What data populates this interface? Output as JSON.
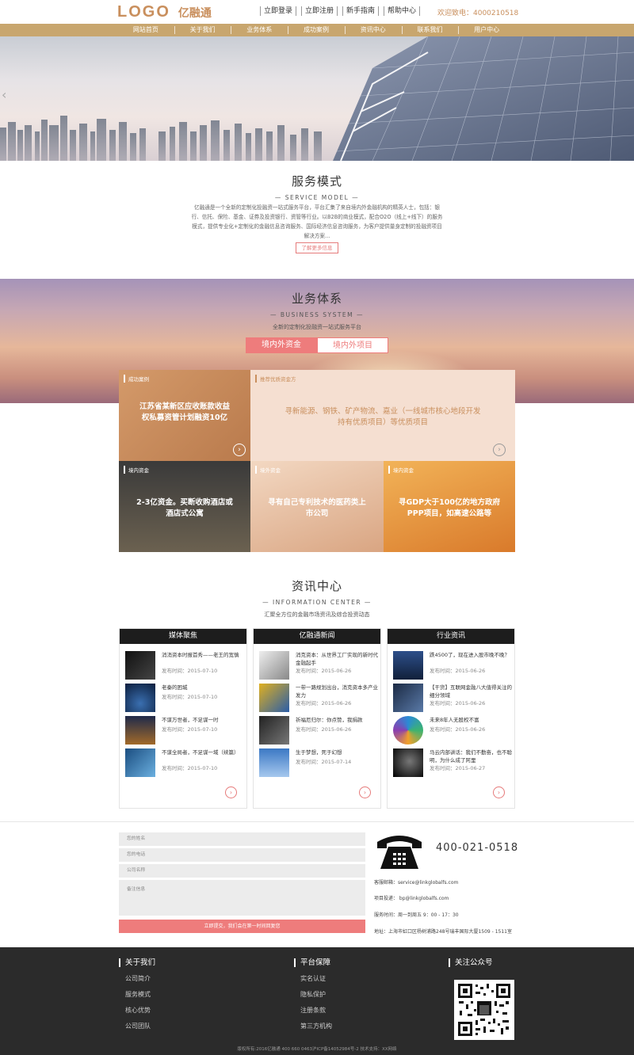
{
  "header": {
    "logo_en": "LOGO",
    "logo_cn": "亿融通",
    "links": [
      "立即登录",
      "立即注册",
      "新手指南",
      "帮助中心"
    ],
    "hotline": "欢迎致电：4000210518"
  },
  "nav": [
    "网站首页",
    "关于我们",
    "业务体系",
    "成功案例",
    "资讯中心",
    "联系我们",
    "用户中心"
  ],
  "service": {
    "title": "服务模式",
    "subtitle": "— SERVICE MODEL —",
    "desc": "亿融通是一个全新的定制化投融资一站式服务平台，平台汇集了来自境内外金融机构的精英人士，包括：银行、信托、保险、基金、证券及投资银行、资管等行业。以B2B的商业模式，配合O2O（线上+线下）的服务模式，提供专业化+定制化的金融信息咨询服务、国际经济信息咨询服务，为客户提供量身定制的投融资项目解决方案...",
    "button": "了解更多信息"
  },
  "business": {
    "title": "业务体系",
    "subtitle": "— BUSINESS SYSTEM —",
    "tagline": "全新的定制化投融资一站式服务平台",
    "tabs": [
      "境内外资金",
      "境内外项目"
    ],
    "cards": [
      {
        "tag": "成功案例",
        "text": "江苏省某新区应收账款收益权私募资管计划融资10亿"
      },
      {
        "tag": "推荐优质资金方",
        "text": "寻新能源、钢铁、矿产物流、嘉业（一线城市核心地段开发持有优质项目）等优质项目"
      },
      {
        "tag": "境内资金",
        "text": "2-3亿资金。买断收购酒店或酒店式公寓"
      },
      {
        "tag": "境外资金",
        "text": "寻有自己专利技术的医药类上市公司"
      },
      {
        "tag": "境内资金",
        "text": "寻GDP大于100亿的地方政府PPP项目，如高速公路等"
      }
    ]
  },
  "info": {
    "title": "资讯中心",
    "subtitle": "— INFORMATION CENTER —",
    "tagline": "汇聚全方位的金融市场资讯及综合投资动态",
    "columns": [
      {
        "head": "媒体聚焦",
        "items": [
          {
            "t": "消消资本时报首秀——老王的宽慎",
            "d": "发布时间：2015-07-10"
          },
          {
            "t": "老秦的困城",
            "d": "发布时间：2015-07-10"
          },
          {
            "t": "不谋万世者，不足谋一时",
            "d": "发布时间：2015-07-10"
          },
          {
            "t": "不谋全局者，不足谋一域（续篇）",
            "d": "发布时间：2015-07-10"
          }
        ]
      },
      {
        "head": "亿融通新闻",
        "items": [
          {
            "t": "消克资本：从世界工厂实现的新时代金融起手",
            "d": "发布时间：2015-06-26"
          },
          {
            "t": "一带一路规划出台，消克资本多产业发力",
            "d": "发布时间：2015-06-26"
          },
          {
            "t": "祈福厄归尔：你点赞，我捐款",
            "d": "发布时间：2015-06-26"
          },
          {
            "t": "生于梦想，死于幻想",
            "d": "发布时间：2015-07-14"
          }
        ]
      },
      {
        "head": "行业资讯",
        "items": [
          {
            "t": "跌4500了，现在进入股市晚不晚？",
            "d": "发布时间：2015-06-26"
          },
          {
            "t": "【干货】互联网金融八大值得关注的细分领域",
            "d": "发布时间：2015-06-26"
          },
          {
            "t": "未来8年人无股权不富",
            "d": "发布时间：2015-06-26"
          },
          {
            "t": "马云内部讲话：我们不勤奋，也不聪明，为什么成了阿里",
            "d": "发布时间：2015-06-27"
          }
        ]
      }
    ]
  },
  "contact": {
    "fields": [
      "您的姓名",
      "您的电话",
      "公司名称",
      "备注信息"
    ],
    "submit": "立即提交，我们会在第一时间回复您",
    "phone": "400-021-0518",
    "email": "客服邮箱：service@linkglobalfs.com",
    "project": "项目投递：  bp@linkglobalfs.com",
    "hours": "服务时间：周一到周五 9：00 - 17：30",
    "address": "地址：上海市虹口区杨树浦路248号瑞丰国际大厦1509 - 1511室"
  },
  "footer": {
    "about": {
      "head": "关于我们",
      "links": [
        "公司简介",
        "服务模式",
        "核心优势",
        "公司团队"
      ]
    },
    "platform": {
      "head": "平台保障",
      "links": [
        "实名认证",
        "隐私保护",
        "注册条款",
        "第三方机构"
      ]
    },
    "wechat": {
      "head": "关注公众号"
    },
    "copyright": "版权所有:2016亿融通 400 660 0463沪ICP备14052984号-2 技术支持：XX网络"
  },
  "colors": {
    "accent": "#c98f5d",
    "nav": "#c8a66e",
    "pink": "#ee7c7c",
    "dark": "#2b2b2b"
  }
}
